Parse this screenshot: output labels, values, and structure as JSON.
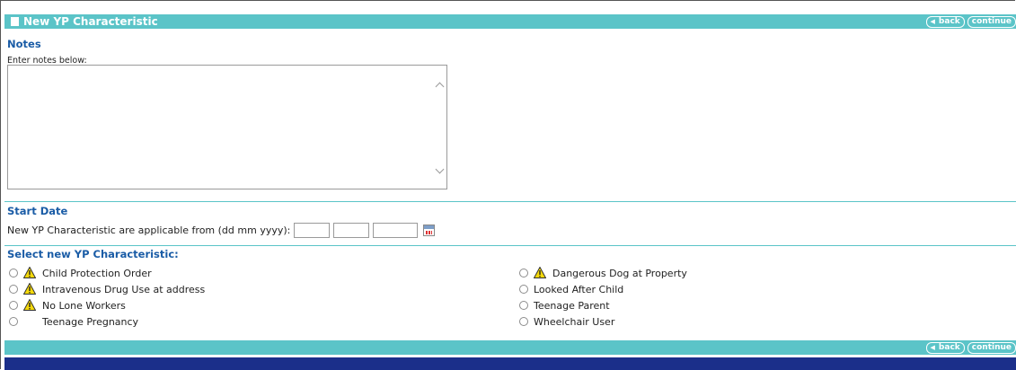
{
  "header": {
    "title": "New YP Characteristic",
    "back_label": "back",
    "continue_label": "continue"
  },
  "notes": {
    "section_title": "Notes",
    "hint": "Enter notes below:",
    "value": ""
  },
  "start_date": {
    "section_title": "Start Date",
    "label": "New YP Characteristic are applicable from (dd mm yyyy):",
    "day": "",
    "month": "",
    "year": ""
  },
  "characteristics": {
    "section_title": "Select new YP Characteristic:",
    "left": [
      {
        "label": "Child Protection Order",
        "warning": true
      },
      {
        "label": "Intravenous Drug Use at address",
        "warning": true
      },
      {
        "label": "No Lone Workers",
        "warning": true
      },
      {
        "label": "Teenage Pregnancy",
        "warning": false
      }
    ],
    "right": [
      {
        "label": "Dangerous Dog at Property",
        "warning": true
      },
      {
        "label": "Looked After Child",
        "warning": false
      },
      {
        "label": "Teenage Parent",
        "warning": false
      },
      {
        "label": "Wheelchair User",
        "warning": false
      }
    ]
  },
  "footer": {
    "back_label": "back",
    "continue_label": "continue"
  },
  "colors": {
    "header_bar": "#5bc4c8",
    "section_title": "#1a5ca6",
    "footer_band": "#1b2f8a",
    "warning": "#f5d90a"
  },
  "icons": {
    "header": "square-icon",
    "warning": "warning-icon",
    "calendar": "calendar-icon",
    "back": "back-arrow-icon"
  }
}
